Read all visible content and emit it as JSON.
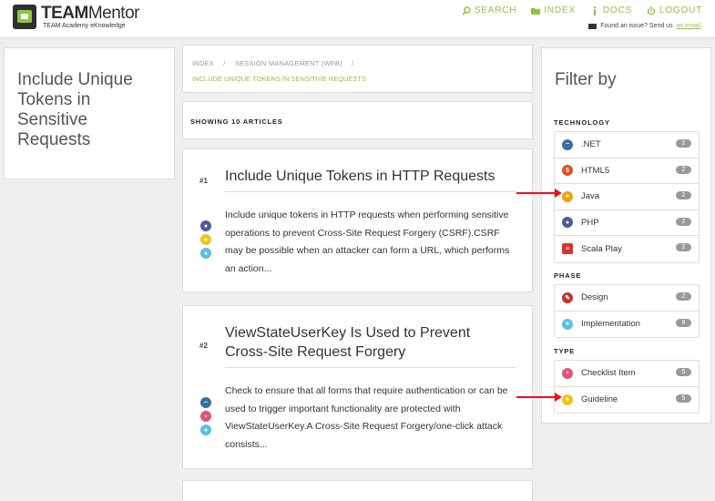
{
  "header": {
    "logo_title_bold": "TEAM",
    "logo_title_light": "Mentor",
    "logo_subtitle": "TEAM Academy eKnowledge",
    "nav": [
      {
        "label": "SEARCH",
        "icon": "search-icon"
      },
      {
        "label": "INDEX",
        "icon": "folder-icon"
      },
      {
        "label": "DOCS",
        "icon": "info-icon"
      },
      {
        "label": "LOGOUT",
        "icon": "power-icon"
      }
    ],
    "issue_text": "Found an issue? Send us",
    "issue_link": "an email",
    "issue_end": "."
  },
  "left": {
    "title": "Include Unique Tokens in Sensitive Requests"
  },
  "breadcrumb": {
    "items": [
      "INDEX",
      "SESSION MANAGEMENT (WEB)"
    ],
    "separator": "/",
    "current": "INCLUDE UNIQUE TOKENS IN SENSITIVE REQUESTS"
  },
  "showing": "SHOWING 10 ARTICLES",
  "articles": [
    {
      "num": "#1",
      "title": "Include Unique Tokens in HTTP Requests",
      "body": "Include unique tokens in HTTP requests when performing sensitive operations to prevent Cross-Site Request Forgery (CSRF).CSRF may be possible when an attacker can form a URL, which performs an action...",
      "icons": [
        "php-icon",
        "guideline-icon",
        "implementation-icon"
      ]
    },
    {
      "num": "#2",
      "title": "ViewStateUserKey Is Used to Prevent Cross-Site Request Forgery",
      "body": "Check to ensure that all forms that require authentication or can be used to trigger important functionality are protected with ViewStateUserKey.A Cross-Site Request Forgery/one-click attack consists...",
      "icons": [
        "dotnet-icon",
        "checklist-icon",
        "implementation-icon"
      ]
    }
  ],
  "filter": {
    "title": "Filter by",
    "sections": [
      {
        "label": "TECHNOLOGY",
        "items": [
          {
            "label": ".NET",
            "count": "2",
            "icon": "dotnet-icon",
            "color": "#3a6ea5"
          },
          {
            "label": "HTML5",
            "count": "2",
            "icon": "html5-icon",
            "color": "#e34c26"
          },
          {
            "label": "Java",
            "count": "2",
            "icon": "java-icon",
            "color": "#f0a30a"
          },
          {
            "label": "PHP",
            "count": "2",
            "icon": "php-icon",
            "color": "#4f5b93"
          },
          {
            "label": "Scala Play",
            "count": "2",
            "icon": "scala-icon",
            "color": "#dc322f"
          }
        ]
      },
      {
        "label": "PHASE",
        "items": [
          {
            "label": "Design",
            "count": "2",
            "icon": "design-icon",
            "color": "#c9302c"
          },
          {
            "label": "Implementation",
            "count": "8",
            "icon": "implementation-icon",
            "color": "#5bc0de"
          }
        ]
      },
      {
        "label": "TYPE",
        "items": [
          {
            "label": "Checklist Item",
            "count": "5",
            "icon": "checklist-icon",
            "color": "#e05577"
          },
          {
            "label": "Guideline",
            "count": "5",
            "icon": "guideline-icon",
            "color": "#f0c419"
          }
        ]
      }
    ]
  },
  "colors": {
    "accent": "#8fc541",
    "annotation_arrow": "#e3141c"
  }
}
